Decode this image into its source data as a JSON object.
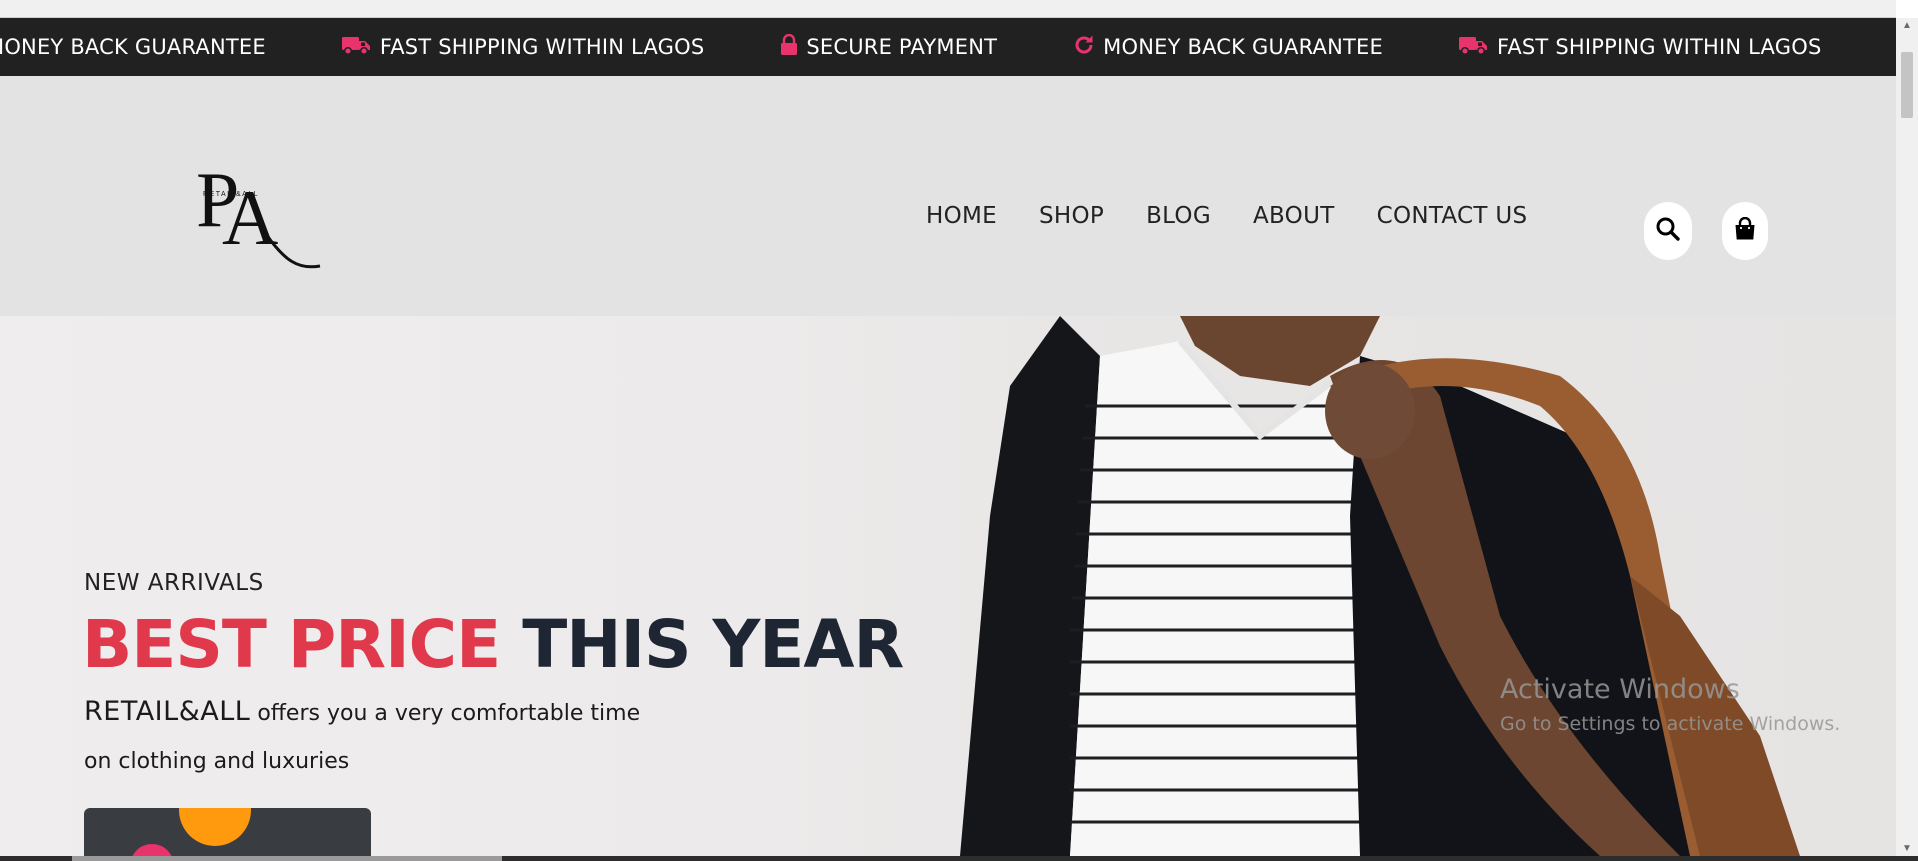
{
  "ticker": {
    "items": [
      {
        "icon": "refresh-icon",
        "label": "MONEY BACK GUARANTEE"
      },
      {
        "icon": "truck-icon",
        "label": "FAST SHIPPING WITHIN LAGOS"
      },
      {
        "icon": "lock-icon",
        "label": "SECURE PAYMENT"
      },
      {
        "icon": "refresh-icon",
        "label": "MONEY BACK GUARANTEE"
      },
      {
        "icon": "truck-icon",
        "label": "FAST SHIPPING WITHIN LAGOS"
      }
    ],
    "icon_color": "#e8336d"
  },
  "brand": {
    "logo_text": "RETAIL&ALL",
    "monogram": "RA"
  },
  "nav": {
    "items": [
      "HOME",
      "SHOP",
      "BLOG",
      "ABOUT",
      "CONTACT US"
    ]
  },
  "header_icons": [
    "search-icon",
    "shopping-bag-icon"
  ],
  "hero": {
    "kicker": "NEW ARRIVALS",
    "title_accent": "BEST PRICE",
    "title_rest": "THIS YEAR",
    "sub_brand": "RETAIL&ALL",
    "sub_line1": "offers you a very comfortable time",
    "sub_line2": "on clothing and luxuries",
    "accent_color": "#e0394b"
  },
  "watermark": {
    "title": "Activate Windows",
    "subtitle": "Go to Settings to activate Windows."
  }
}
